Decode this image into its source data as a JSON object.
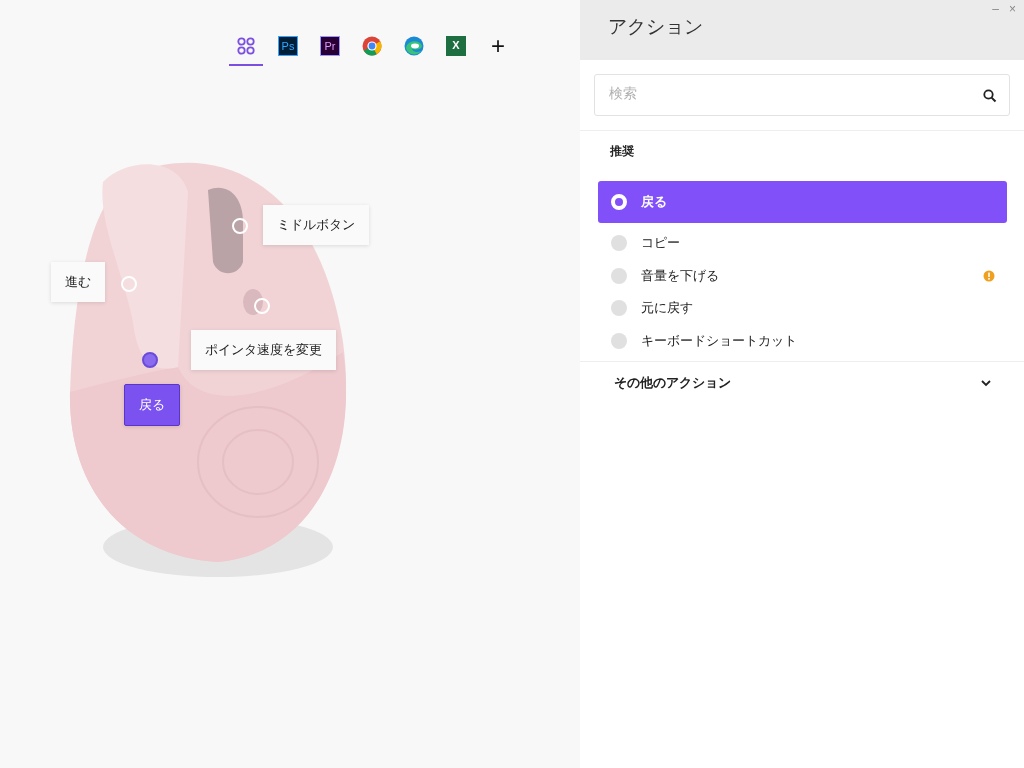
{
  "apps": [
    {
      "kind": "all",
      "selected": true
    },
    {
      "kind": "ps",
      "label": "Ps",
      "selected": false
    },
    {
      "kind": "pr",
      "label": "Pr",
      "selected": false
    },
    {
      "kind": "chrome",
      "selected": false
    },
    {
      "kind": "edge",
      "selected": false
    },
    {
      "kind": "excel",
      "label": "X",
      "selected": false
    },
    {
      "kind": "add",
      "label": "+",
      "selected": false
    }
  ],
  "callouts": [
    {
      "label": "ミドルボタン",
      "selected": false
    },
    {
      "label": "進む",
      "selected": false
    },
    {
      "label": "ポインタ速度を変更",
      "selected": false
    },
    {
      "label": "戻る",
      "selected": true
    }
  ],
  "panel": {
    "title": "アクション",
    "window_controls": [
      "–",
      "×"
    ],
    "search": {
      "placeholder": "検索"
    },
    "section_title": "推奨",
    "actions": [
      {
        "label": "戻る",
        "selected": true,
        "warning": false
      },
      {
        "label": "コピー",
        "selected": false,
        "warning": false
      },
      {
        "label": "音量を下げる",
        "selected": false,
        "warning": true
      },
      {
        "label": "元に戻す",
        "selected": false,
        "warning": false
      },
      {
        "label": "キーボードショートカット",
        "selected": false,
        "warning": false
      }
    ],
    "more": {
      "label": "その他のアクション",
      "expanded": false
    }
  }
}
